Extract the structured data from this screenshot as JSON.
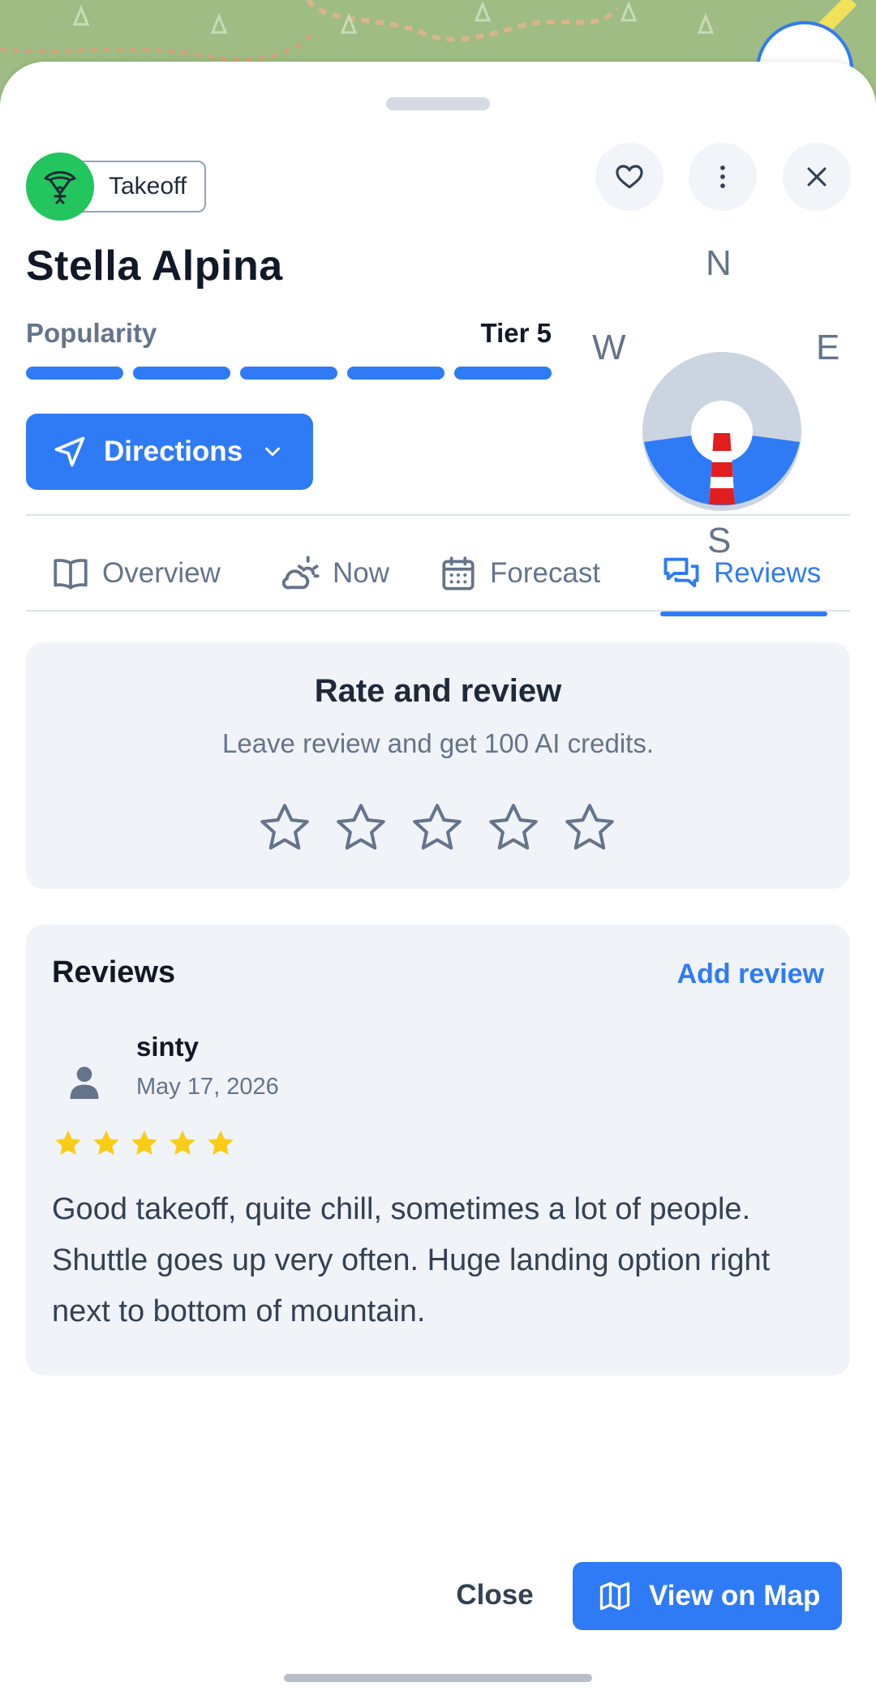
{
  "place": {
    "type_label": "Takeoff",
    "name": "Stella Alpina",
    "popularity_label": "Popularity",
    "popularity_tier": "Tier 5",
    "popularity_level": 5,
    "popularity_max": 5,
    "directions_label": "Directions"
  },
  "compass": {
    "north": "N",
    "south": "S",
    "east": "E",
    "west": "W",
    "favorable_sector": "SE-S-SW"
  },
  "tabs": [
    {
      "label": "Overview",
      "icon": "book-icon",
      "active": false
    },
    {
      "label": "Now",
      "icon": "partly-sunny-icon",
      "active": false
    },
    {
      "label": "Forecast",
      "icon": "calendar-icon",
      "active": false
    },
    {
      "label": "Reviews",
      "icon": "chat-bubbles-icon",
      "active": true
    }
  ],
  "rate_card": {
    "title": "Rate and review",
    "subtitle": "Leave review and get 100 AI credits.",
    "star_count": 5
  },
  "reviews": {
    "heading": "Reviews",
    "add_label": "Add review",
    "items": [
      {
        "user": "sinty",
        "date": "May 17, 2026",
        "rating": 5,
        "text": "Good takeoff, quite chill, sometimes a lot of people. Shuttle goes up very often. Huge landing option right next to bottom of mountain."
      }
    ]
  },
  "footer": {
    "close_label": "Close",
    "map_label": "View on Map"
  },
  "colors": {
    "accent": "#2f7bf5",
    "takeoff_green": "#22c55e",
    "star_yellow": "#facc15"
  }
}
